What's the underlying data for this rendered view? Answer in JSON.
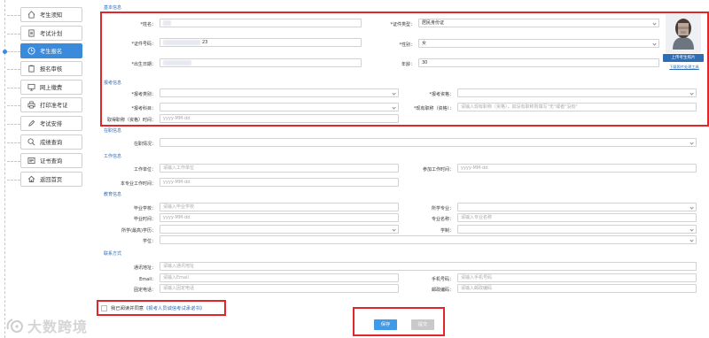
{
  "sidebar": {
    "items": [
      {
        "label": "考生须知",
        "icon": "home-icon"
      },
      {
        "label": "考试计划",
        "icon": "document-icon"
      },
      {
        "label": "考生报名",
        "icon": "clock-icon",
        "active": true
      },
      {
        "label": "报名审核",
        "icon": "clipboard-icon"
      },
      {
        "label": "网上缴费",
        "icon": "monitor-icon"
      },
      {
        "label": "打印准考证",
        "icon": "printer-icon"
      },
      {
        "label": "考试安排",
        "icon": "pencil-icon"
      },
      {
        "label": "成绩查询",
        "icon": "search-icon"
      },
      {
        "label": "证书查询",
        "icon": "certificate-icon"
      },
      {
        "label": "返回首页",
        "icon": "house-icon"
      }
    ]
  },
  "basic": {
    "title": "基本信息",
    "name_label": "*姓名：",
    "id_type_label": "*证件类型：",
    "id_type_value": "居民身份证",
    "id_no_label": "*证件号码：",
    "id_no_value": "23",
    "gender_label": "*性别：",
    "gender_value": "女",
    "birth_label": "*出生日期：",
    "age_label": "年龄：",
    "age_value": "30",
    "upload_photo": "上传考生照片",
    "download_tool": "下载照片处理工具"
  },
  "exam": {
    "title": "报考信息",
    "category_label": "*报考类别：",
    "qualification_label": "*报考资格：",
    "qualification_placeholder": "请输入现有职称（资格），如没有职称则填写\"无\"或者\"没有\"",
    "subject_label": "*报考科目：",
    "title_label": "*现有职称（资格）：",
    "title_placeholder": "请输入现有职称（资格）",
    "obtain_date_label": "取得职称（资格）时间：",
    "obtain_date_placeholder": "yyyy-MM-dd"
  },
  "region": {
    "title": "在职信息",
    "status_label": "在职情况："
  },
  "work": {
    "title": "工作信息",
    "unit_label": "工作单位：",
    "unit_placeholder": "请输入工作单位",
    "start_label": "参加工作时间：",
    "start_placeholder": "yyyy-MM-dd",
    "major_work_label": "本专业工作时间：",
    "major_work_placeholder": "yyyy-MM-dd"
  },
  "edu": {
    "title": "教育信息",
    "school_label": "毕业学校：",
    "school_placeholder": "请输入毕业学校",
    "major_label": "所学专业：",
    "grad_date_label": "毕业时间：",
    "grad_date_placeholder": "yyyy-MM-dd",
    "major_name_label": "专业名称：",
    "major_name_placeholder": "请输入专业名称",
    "degree_label": "所学(最高)学历：",
    "system_label": "学制：",
    "xuewei_label": "学位："
  },
  "contact": {
    "title": "联系方式",
    "address_label": "通讯地址：",
    "address_placeholder": "请输入通讯地址",
    "email_label": "Email：",
    "email_placeholder": "请输入Email",
    "mobile_label": "手机号码：",
    "mobile_placeholder": "请输入手机号码",
    "phone_label": "固定电话：",
    "phone_placeholder": "请输入固定电话",
    "post_label": "邮政编码：",
    "post_placeholder": "请输入邮政编码"
  },
  "agreement": {
    "text": "我已阅读并同意",
    "link": "《报考人员诚信考试承诺书》"
  },
  "buttons": {
    "save": "保存",
    "submit": "提交"
  },
  "watermark": {
    "text": "大数跨境"
  },
  "colors": {
    "accent": "#3a8bdc",
    "highlight": "#e0262a",
    "link": "#2f6db5"
  }
}
